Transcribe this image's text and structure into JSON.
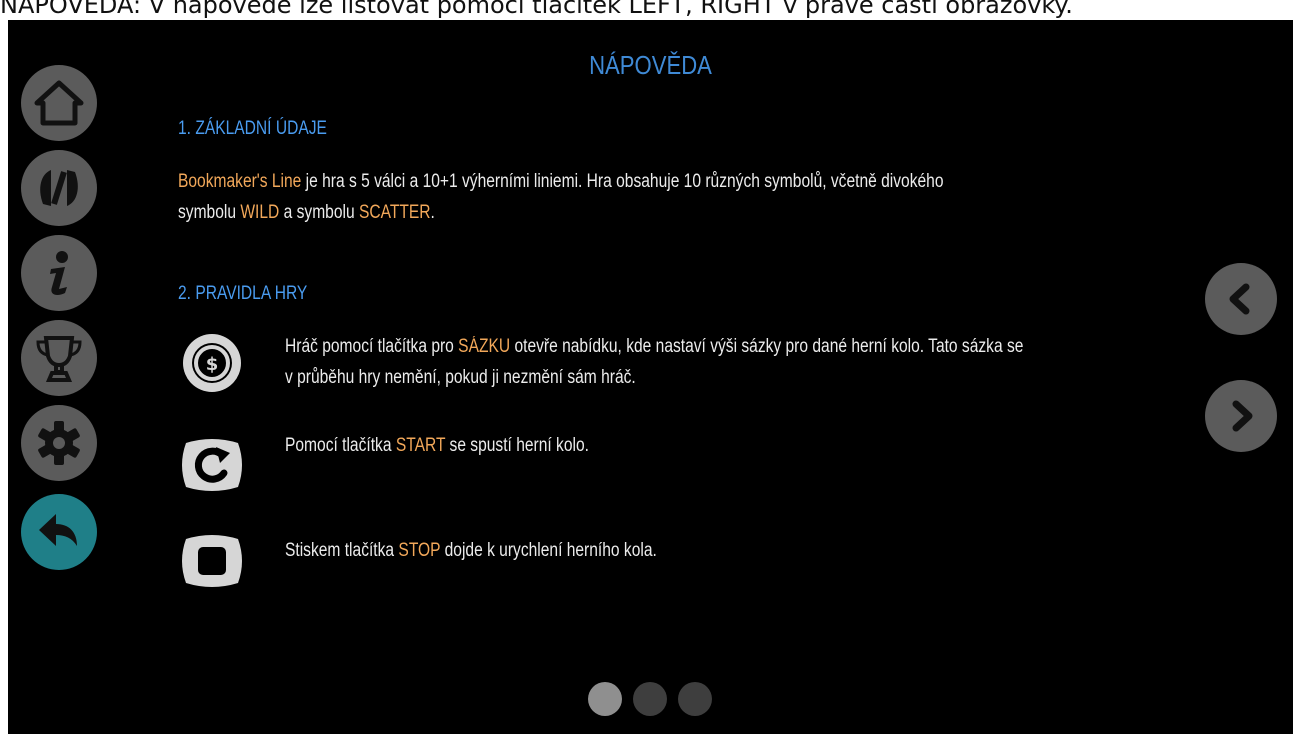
{
  "caption": "NÁPOVĚDA: V nápovědě lze listovat pomocí tlačítek LEFT, RIGHT v pravé části obrazovky.",
  "title": "NÁPOVĚDA",
  "sidebar": {
    "icons": [
      "home-icon",
      "logo-icon",
      "info-icon",
      "trophy-icon",
      "gear-icon",
      "back-arrow-icon"
    ]
  },
  "section1": {
    "heading": "1. ZÁKLADNÍ ÚDAJE",
    "line1_hl": "Bookmaker's Line",
    "line1_rest": " je hra s 5 válci a 10+1 výherními liniemi. Hra obsahuje 10 různých symbolů, včetně divokého",
    "line2_pre": "symbolu ",
    "line2_wild": "WILD",
    "line2_mid": " a symbolu ",
    "line2_scatter": "SCATTER",
    "line2_end": "."
  },
  "section2": {
    "heading": "2. PRAVIDLA HRY",
    "bet": {
      "pre": "Hráč pomocí tlačítka pro ",
      "hl": "SÁZKU",
      "post": " otevře nabídku, kde nastaví výši sázky pro dané herní kolo. Tato sázka se",
      "line2": "v průběhu hry nemění, pokud ji nezmění sám hráč.",
      "icon": "bet-coin-icon"
    },
    "start": {
      "pre": "Pomocí tlačítka ",
      "hl": "START",
      "post": " se spustí herní kolo.",
      "icon": "start-icon"
    },
    "stop": {
      "pre": "Stiskem tlačítka ",
      "hl": "STOP",
      "post": " dojde k urychlení herního kola.",
      "icon": "stop-icon"
    }
  },
  "pagination": {
    "pages": 3,
    "current": 1
  },
  "colors": {
    "accent_blue": "#3f8ad6",
    "highlight_orange": "#f2a85a",
    "back_teal": "#1f7f88",
    "button_gray": "#5b5b5b"
  }
}
